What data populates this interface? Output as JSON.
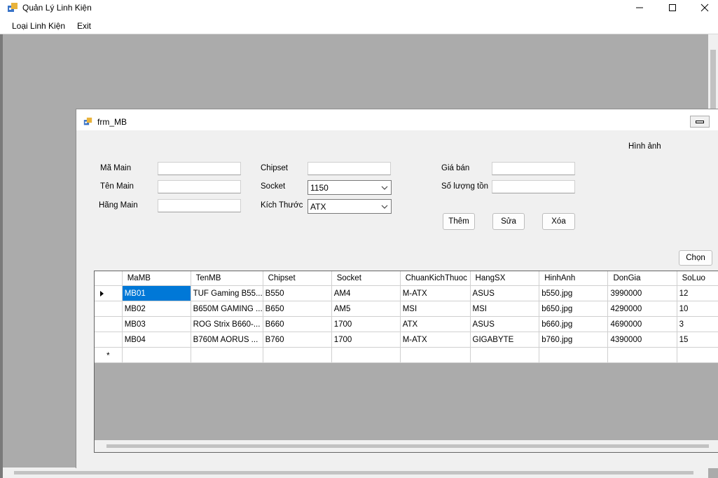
{
  "window": {
    "title": "Quản Lý Linh Kiện"
  },
  "menu": {
    "item1": "Loại Linh Kiện",
    "item2": "Exit"
  },
  "child": {
    "title": "frm_MB"
  },
  "labels": {
    "ma_main": "Mã Main",
    "ten_main": "Tên Main",
    "hang_main": "Hãng Main",
    "chipset": "Chipset",
    "socket": "Socket",
    "kich_thuoc": "Kích Thước",
    "gia_ban": "Giá bán",
    "so_luong_ton": "Số lượng tồn",
    "hinh_anh": "Hình ảnh"
  },
  "fields": {
    "ma_main": "",
    "ten_main": "",
    "hang_main": "",
    "chipset": "",
    "gia_ban": "",
    "so_luong_ton": "",
    "socket": "1150",
    "kich_thuoc": "ATX"
  },
  "buttons": {
    "them": "Thêm",
    "sua": "Sửa",
    "xoa": "Xóa",
    "chon": "Chọn"
  },
  "grid": {
    "columns": [
      "MaMB",
      "TenMB",
      "Chipset",
      "Socket",
      "ChuanKichThuoc",
      "HangSX",
      "HinhAnh",
      "DonGia",
      "SoLuo"
    ],
    "rows": [
      [
        "MB01",
        "TUF Gaming B55...",
        "B550",
        "AM4",
        "M-ATX",
        "ASUS",
        "b550.jpg",
        "3990000",
        "12"
      ],
      [
        "MB02",
        "B650M GAMING ...",
        "B650",
        "AM5",
        "MSI",
        "MSI",
        "b650.jpg",
        "4290000",
        "10"
      ],
      [
        "MB03",
        "ROG Strix B660-...",
        "B660",
        "1700",
        "ATX",
        "ASUS",
        "b660.jpg",
        "4690000",
        "3"
      ],
      [
        "MB04",
        "B760M AORUS ...",
        "B760",
        "1700",
        "M-ATX",
        "GIGABYTE",
        "b760.jpg",
        "4390000",
        "15"
      ]
    ],
    "new_row_marker": "*"
  },
  "colors": {
    "selection": "#0078d7",
    "workspace": "#ababab"
  }
}
